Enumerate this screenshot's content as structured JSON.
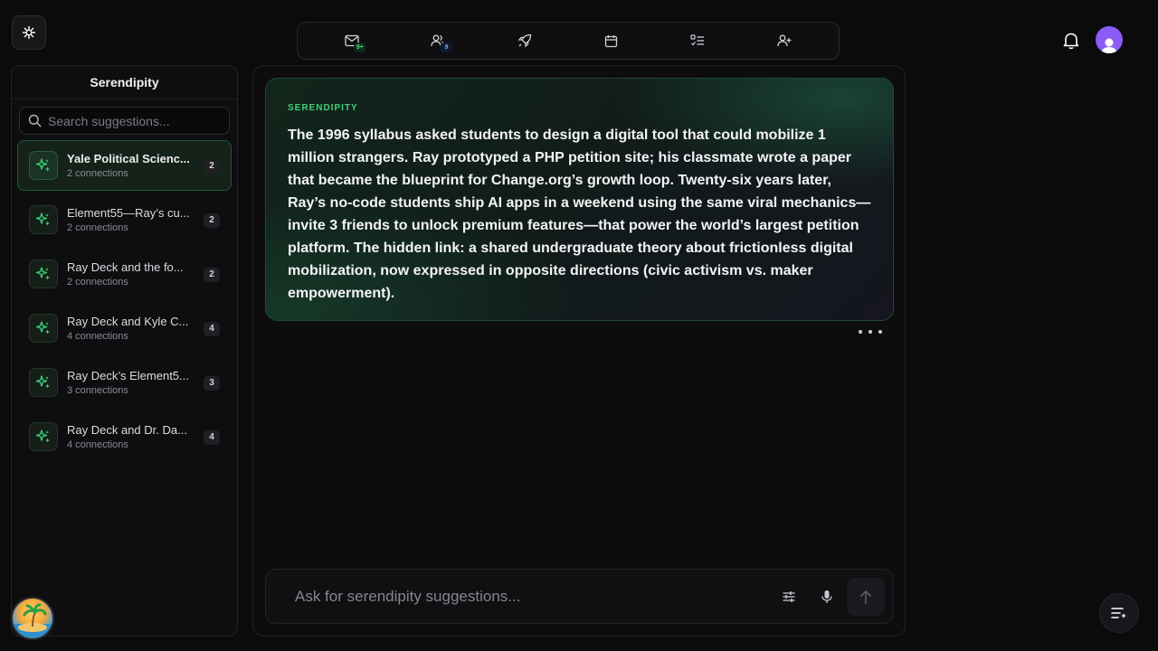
{
  "topnav": {
    "items": [
      {
        "icon": "mail-icon",
        "badge": "9+",
        "badge_color": "#4ade80"
      },
      {
        "icon": "users-icon",
        "badge": "9",
        "badge_color": "#60a5fa"
      },
      {
        "icon": "rocket-icon"
      },
      {
        "icon": "calendar-icon"
      },
      {
        "icon": "checklist-icon"
      },
      {
        "icon": "add-user-icon"
      }
    ]
  },
  "sidebar": {
    "title": "Serendipity",
    "search_placeholder": "Search suggestions...",
    "items": [
      {
        "title": "Yale Political Scienc...",
        "subtitle": "2 connections",
        "count": "2",
        "active": true
      },
      {
        "title": "Element55—Ray’s cu...",
        "subtitle": "2 connections",
        "count": "2"
      },
      {
        "title": "Ray Deck and the fo...",
        "subtitle": "2 connections",
        "count": "2"
      },
      {
        "title": "Ray Deck and Kyle C...",
        "subtitle": "4 connections",
        "count": "4"
      },
      {
        "title": "Ray Deck’s Element5...",
        "subtitle": "3 connections",
        "count": "3"
      },
      {
        "title": "Ray Deck and Dr. Da...",
        "subtitle": "4 connections",
        "count": "4"
      }
    ]
  },
  "card": {
    "label": "SERENDIPITY",
    "text": "The 1996 syllabus asked students to design a digital tool that could mobilize 1 million strangers. Ray prototyped a PHP petition site; his classmate wrote a paper that became the blueprint for Change.org’s growth loop. Twenty-six years later, Ray’s no-code students ship AI apps in a weekend using the same viral mechanics—invite 3 friends to unlock premium features—that power the world’s largest petition platform. The hidden link: a shared undergraduate theory about frictionless digital mobilization, now expressed in opposite directions (civic activism vs. maker empowerment)."
  },
  "composer": {
    "placeholder": "Ask for serendipity suggestions..."
  },
  "colors": {
    "accent": "#3fcf7a",
    "avatar": "#8b5cf6"
  }
}
